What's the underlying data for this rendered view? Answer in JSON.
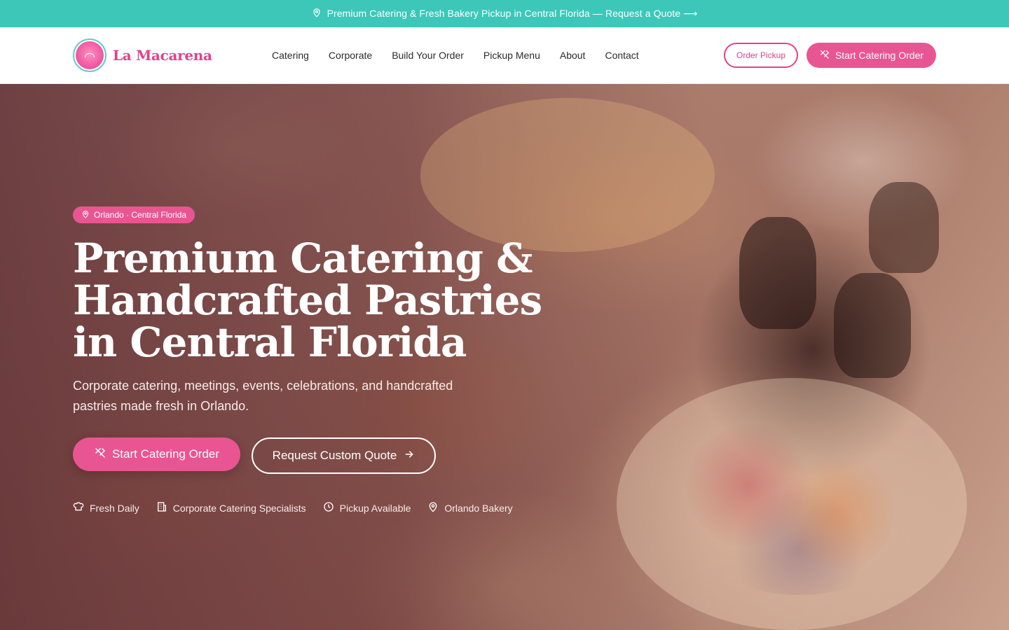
{
  "announcement": {
    "text": "Premium Catering & Fresh Bakery Pickup in Central Florida — Request a Quote ⟶",
    "icon": "map-pin-icon"
  },
  "brand": {
    "name": "La Macarena",
    "primary_color": "#e95592",
    "accent_color": "#3cc7b9"
  },
  "nav": {
    "items": [
      {
        "label": "Catering"
      },
      {
        "label": "Corporate"
      },
      {
        "label": "Build Your Order"
      },
      {
        "label": "Pickup Menu"
      },
      {
        "label": "About"
      },
      {
        "label": "Contact"
      }
    ],
    "order_pickup_label": "Order Pickup",
    "start_catering_label": "Start Catering Order"
  },
  "hero": {
    "location_pill": "Orlando · Central Florida",
    "headline": "Premium Catering & Handcrafted Pastries in Central Florida",
    "subhead": "Corporate catering, meetings, events, celebrations, and handcrafted pastries made fresh in Orlando.",
    "primary_cta": "Start Catering Order",
    "secondary_cta": "Request Custom Quote",
    "features": [
      {
        "label": "Fresh Daily",
        "icon": "chef-hat-icon"
      },
      {
        "label": "Corporate Catering Specialists",
        "icon": "building-icon"
      },
      {
        "label": "Pickup Available",
        "icon": "clock-icon"
      },
      {
        "label": "Orlando Bakery",
        "icon": "map-pin-icon"
      }
    ]
  }
}
